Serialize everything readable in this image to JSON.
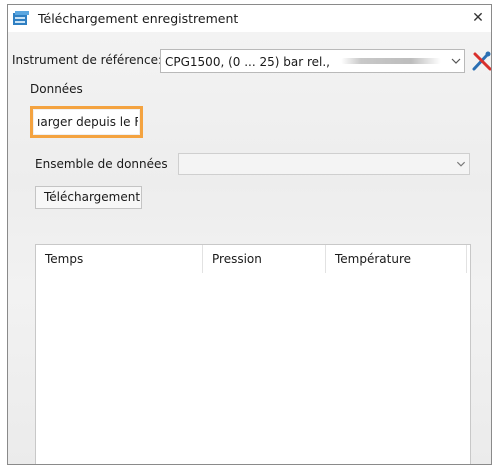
{
  "window": {
    "title": "Téléchargement enregistrement",
    "close_glyph": "✕",
    "app_icon": "database-icon"
  },
  "instrument": {
    "label": "Instrument de référence:",
    "value": "CPG1500, (0 ... 25) bar rel.,"
  },
  "data_section": {
    "label": "Données",
    "load_button_label": "Charger depuis le P",
    "load_button_visible_label": "ıarger depuis le F",
    "highlight_color": "#f4a340"
  },
  "dataset": {
    "label": "Ensemble de données",
    "value": ""
  },
  "download_button_label": "Téléchargement",
  "table": {
    "columns": [
      "Temps",
      "Pression",
      "Température"
    ],
    "rows": []
  }
}
